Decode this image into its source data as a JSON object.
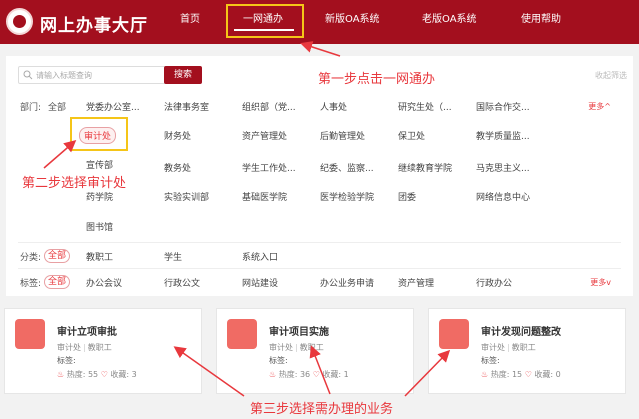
{
  "header": {
    "title": "网上办事大厅",
    "nav": [
      "首页",
      "一网通办",
      "新版OA系统",
      "老版OA系统",
      "使用帮助"
    ]
  },
  "search": {
    "placeholder": "请输入标题查询",
    "button": "搜索",
    "collapse": "收起筛选"
  },
  "filters": {
    "dept_label": "部门:",
    "all": "全部",
    "more": "更多",
    "departments": [
      [
        "党委办公室...",
        "法律事务室",
        "组织部（党...",
        "人事处",
        "研究生处（...",
        "国际合作交..."
      ],
      [
        "审计处",
        "财务处",
        "资产管理处",
        "后勤管理处",
        "保卫处",
        "教学质量监..."
      ],
      [
        "宣传部",
        "",
        "",
        "",
        "",
        ""
      ],
      [
        "",
        "教务处",
        "学生工作处...",
        "纪委、监察...",
        "继续教育学院",
        "马克思主义..."
      ],
      [
        "药学院",
        "实验实训部",
        "基础医学院",
        "医学检验学院",
        "团委",
        "网络信息中心"
      ],
      [
        "图书馆"
      ]
    ],
    "category_label": "分类:",
    "categories": [
      "教职工",
      "学生",
      "系统入口"
    ],
    "tag_label": "标签:",
    "tags": [
      "办公会议",
      "行政公文",
      "网站建设",
      "办公业务申请",
      "资产管理",
      "行政办公"
    ]
  },
  "cards": [
    {
      "title": "审计立项审批",
      "dept": "审计处",
      "audience": "教职工",
      "tag_label": "标签:",
      "hot_label": "热度:",
      "hot": "55",
      "fav_label": "收藏:",
      "fav": "3"
    },
    {
      "title": "审计项目实施",
      "dept": "审计处",
      "audience": "教职工",
      "tag_label": "标签:",
      "hot_label": "热度:",
      "hot": "36",
      "fav_label": "收藏:",
      "fav": "1"
    },
    {
      "title": "审计发现问题整改",
      "dept": "审计处",
      "audience": "教职工",
      "tag_label": "标签:",
      "hot_label": "热度:",
      "hot": "15",
      "fav_label": "收藏:",
      "fav": "0"
    }
  ],
  "annotations": {
    "step1": "第一步点击一网通办",
    "step2": "第二步选择审计处",
    "step3": "第三步选择需办理的业务"
  },
  "colors": {
    "brand": "#a30f1e",
    "accent": "#e8383d",
    "highlight": "#f5c518"
  }
}
